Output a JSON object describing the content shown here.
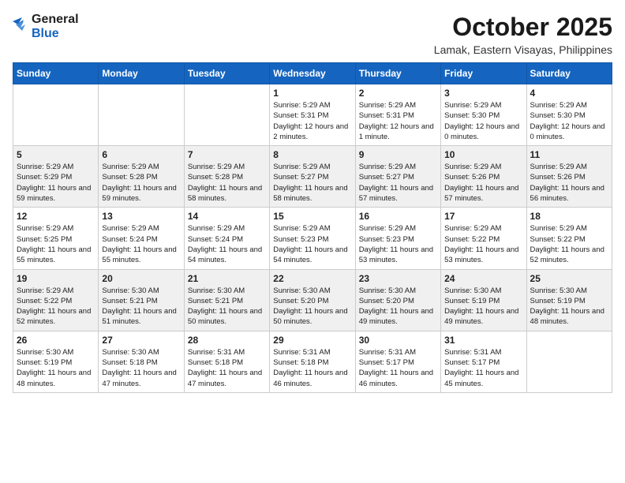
{
  "header": {
    "logo_line1": "General",
    "logo_line2": "Blue",
    "month": "October 2025",
    "location": "Lamak, Eastern Visayas, Philippines"
  },
  "weekdays": [
    "Sunday",
    "Monday",
    "Tuesday",
    "Wednesday",
    "Thursday",
    "Friday",
    "Saturday"
  ],
  "weeks": [
    [
      {
        "day": "",
        "sunrise": "",
        "sunset": "",
        "daylight": ""
      },
      {
        "day": "",
        "sunrise": "",
        "sunset": "",
        "daylight": ""
      },
      {
        "day": "",
        "sunrise": "",
        "sunset": "",
        "daylight": ""
      },
      {
        "day": "1",
        "sunrise": "Sunrise: 5:29 AM",
        "sunset": "Sunset: 5:31 PM",
        "daylight": "Daylight: 12 hours and 2 minutes."
      },
      {
        "day": "2",
        "sunrise": "Sunrise: 5:29 AM",
        "sunset": "Sunset: 5:31 PM",
        "daylight": "Daylight: 12 hours and 1 minute."
      },
      {
        "day": "3",
        "sunrise": "Sunrise: 5:29 AM",
        "sunset": "Sunset: 5:30 PM",
        "daylight": "Daylight: 12 hours and 0 minutes."
      },
      {
        "day": "4",
        "sunrise": "Sunrise: 5:29 AM",
        "sunset": "Sunset: 5:30 PM",
        "daylight": "Daylight: 12 hours and 0 minutes."
      }
    ],
    [
      {
        "day": "5",
        "sunrise": "Sunrise: 5:29 AM",
        "sunset": "Sunset: 5:29 PM",
        "daylight": "Daylight: 11 hours and 59 minutes."
      },
      {
        "day": "6",
        "sunrise": "Sunrise: 5:29 AM",
        "sunset": "Sunset: 5:28 PM",
        "daylight": "Daylight: 11 hours and 59 minutes."
      },
      {
        "day": "7",
        "sunrise": "Sunrise: 5:29 AM",
        "sunset": "Sunset: 5:28 PM",
        "daylight": "Daylight: 11 hours and 58 minutes."
      },
      {
        "day": "8",
        "sunrise": "Sunrise: 5:29 AM",
        "sunset": "Sunset: 5:27 PM",
        "daylight": "Daylight: 11 hours and 58 minutes."
      },
      {
        "day": "9",
        "sunrise": "Sunrise: 5:29 AM",
        "sunset": "Sunset: 5:27 PM",
        "daylight": "Daylight: 11 hours and 57 minutes."
      },
      {
        "day": "10",
        "sunrise": "Sunrise: 5:29 AM",
        "sunset": "Sunset: 5:26 PM",
        "daylight": "Daylight: 11 hours and 57 minutes."
      },
      {
        "day": "11",
        "sunrise": "Sunrise: 5:29 AM",
        "sunset": "Sunset: 5:26 PM",
        "daylight": "Daylight: 11 hours and 56 minutes."
      }
    ],
    [
      {
        "day": "12",
        "sunrise": "Sunrise: 5:29 AM",
        "sunset": "Sunset: 5:25 PM",
        "daylight": "Daylight: 11 hours and 55 minutes."
      },
      {
        "day": "13",
        "sunrise": "Sunrise: 5:29 AM",
        "sunset": "Sunset: 5:24 PM",
        "daylight": "Daylight: 11 hours and 55 minutes."
      },
      {
        "day": "14",
        "sunrise": "Sunrise: 5:29 AM",
        "sunset": "Sunset: 5:24 PM",
        "daylight": "Daylight: 11 hours and 54 minutes."
      },
      {
        "day": "15",
        "sunrise": "Sunrise: 5:29 AM",
        "sunset": "Sunset: 5:23 PM",
        "daylight": "Daylight: 11 hours and 54 minutes."
      },
      {
        "day": "16",
        "sunrise": "Sunrise: 5:29 AM",
        "sunset": "Sunset: 5:23 PM",
        "daylight": "Daylight: 11 hours and 53 minutes."
      },
      {
        "day": "17",
        "sunrise": "Sunrise: 5:29 AM",
        "sunset": "Sunset: 5:22 PM",
        "daylight": "Daylight: 11 hours and 53 minutes."
      },
      {
        "day": "18",
        "sunrise": "Sunrise: 5:29 AM",
        "sunset": "Sunset: 5:22 PM",
        "daylight": "Daylight: 11 hours and 52 minutes."
      }
    ],
    [
      {
        "day": "19",
        "sunrise": "Sunrise: 5:29 AM",
        "sunset": "Sunset: 5:22 PM",
        "daylight": "Daylight: 11 hours and 52 minutes."
      },
      {
        "day": "20",
        "sunrise": "Sunrise: 5:30 AM",
        "sunset": "Sunset: 5:21 PM",
        "daylight": "Daylight: 11 hours and 51 minutes."
      },
      {
        "day": "21",
        "sunrise": "Sunrise: 5:30 AM",
        "sunset": "Sunset: 5:21 PM",
        "daylight": "Daylight: 11 hours and 50 minutes."
      },
      {
        "day": "22",
        "sunrise": "Sunrise: 5:30 AM",
        "sunset": "Sunset: 5:20 PM",
        "daylight": "Daylight: 11 hours and 50 minutes."
      },
      {
        "day": "23",
        "sunrise": "Sunrise: 5:30 AM",
        "sunset": "Sunset: 5:20 PM",
        "daylight": "Daylight: 11 hours and 49 minutes."
      },
      {
        "day": "24",
        "sunrise": "Sunrise: 5:30 AM",
        "sunset": "Sunset: 5:19 PM",
        "daylight": "Daylight: 11 hours and 49 minutes."
      },
      {
        "day": "25",
        "sunrise": "Sunrise: 5:30 AM",
        "sunset": "Sunset: 5:19 PM",
        "daylight": "Daylight: 11 hours and 48 minutes."
      }
    ],
    [
      {
        "day": "26",
        "sunrise": "Sunrise: 5:30 AM",
        "sunset": "Sunset: 5:19 PM",
        "daylight": "Daylight: 11 hours and 48 minutes."
      },
      {
        "day": "27",
        "sunrise": "Sunrise: 5:30 AM",
        "sunset": "Sunset: 5:18 PM",
        "daylight": "Daylight: 11 hours and 47 minutes."
      },
      {
        "day": "28",
        "sunrise": "Sunrise: 5:31 AM",
        "sunset": "Sunset: 5:18 PM",
        "daylight": "Daylight: 11 hours and 47 minutes."
      },
      {
        "day": "29",
        "sunrise": "Sunrise: 5:31 AM",
        "sunset": "Sunset: 5:18 PM",
        "daylight": "Daylight: 11 hours and 46 minutes."
      },
      {
        "day": "30",
        "sunrise": "Sunrise: 5:31 AM",
        "sunset": "Sunset: 5:17 PM",
        "daylight": "Daylight: 11 hours and 46 minutes."
      },
      {
        "day": "31",
        "sunrise": "Sunrise: 5:31 AM",
        "sunset": "Sunset: 5:17 PM",
        "daylight": "Daylight: 11 hours and 45 minutes."
      },
      {
        "day": "",
        "sunrise": "",
        "sunset": "",
        "daylight": ""
      }
    ]
  ]
}
